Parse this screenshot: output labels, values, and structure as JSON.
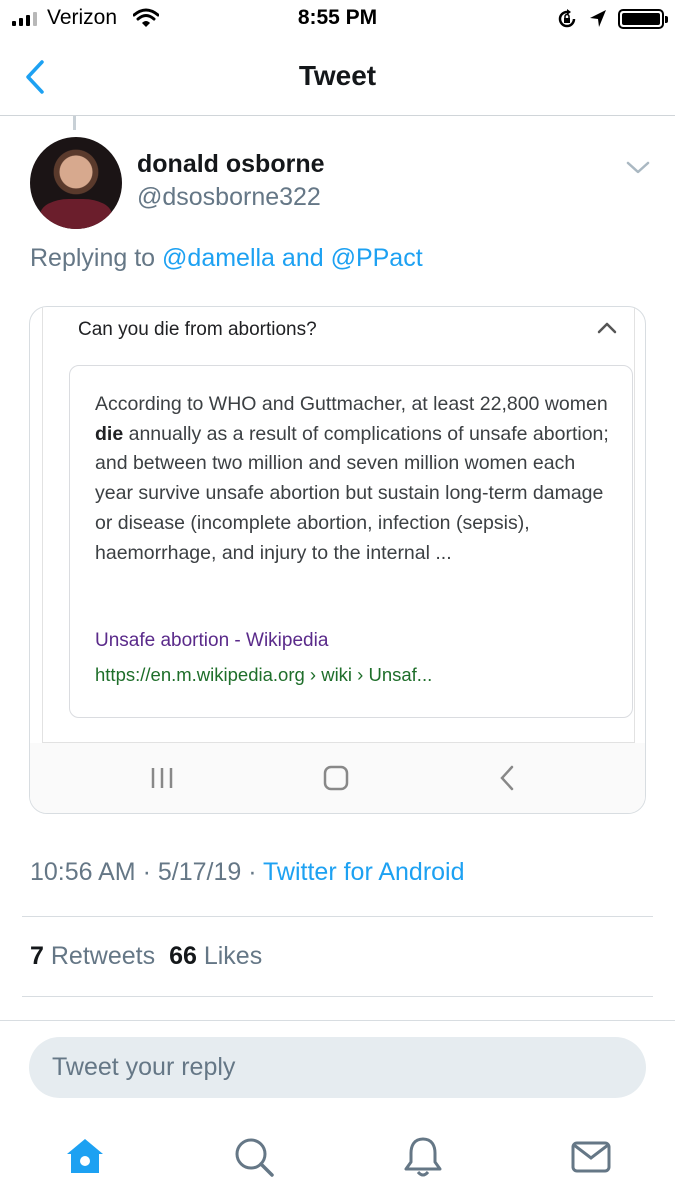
{
  "status_bar": {
    "carrier": "Verizon",
    "time": "8:55 PM",
    "icons": [
      "signal-icon",
      "wifi-icon",
      "rotation-lock-icon",
      "location-arrow-icon",
      "battery-icon"
    ]
  },
  "nav": {
    "title": "Tweet",
    "back_icon": "chevron-left-icon"
  },
  "tweet": {
    "author_name": "donald osborne",
    "author_handle": "@dsosborne322",
    "replying_prefix": "Replying to ",
    "replying_user_1": "@damella",
    "replying_and": " and ",
    "replying_user_2": "@PPact",
    "timestamp": "10:56 AM · 5/17/19 · ",
    "client": "Twitter for Android",
    "retweets_count": "7",
    "retweets_label": "Retweets",
    "likes_count": "66",
    "likes_label": "Likes"
  },
  "embedded_screenshot": {
    "question": "Can you die from abortions?",
    "snippet_before": "According to WHO and Guttmacher, at least 22,800 women ",
    "snippet_bold": "die",
    "snippet_after": " annually as a result of complications of unsafe abortion; and between two million and seven million women each year survive unsafe abortion but sustain long-term damage or disease (incomplete abortion, infection (sepsis), haemorrhage, and injury to the internal ...",
    "source_title": "Unsafe abortion - Wikipedia",
    "source_url": "https://en.m.wikipedia.org › wiki › Unsaf..."
  },
  "composer": {
    "placeholder": "Tweet your reply"
  },
  "tab_bar": {
    "tabs": [
      "home-icon",
      "search-icon",
      "notifications-icon",
      "messages-icon"
    ],
    "accent": "#1da1f2"
  }
}
